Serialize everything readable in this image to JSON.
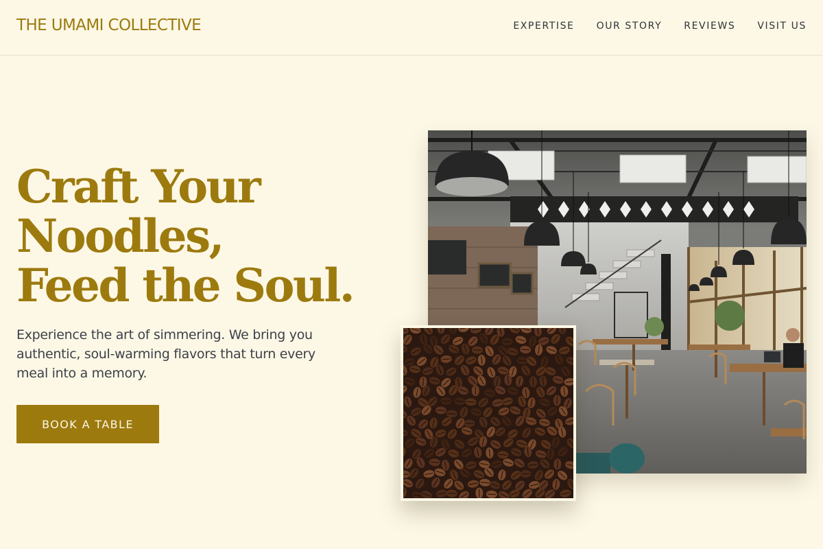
{
  "header": {
    "logo": "THE UMAMI COLLECTIVE",
    "nav": [
      {
        "label": "EXPERTISE"
      },
      {
        "label": "OUR STORY"
      },
      {
        "label": "REVIEWS"
      },
      {
        "label": "VISIT US"
      }
    ]
  },
  "hero": {
    "title_lines": [
      "Craft Your",
      "Noodles,",
      "Feed the Soul."
    ],
    "subtitle": "Experience the art of simmering. We bring you authentic, soul-warming flavors that turn every meal into a memory.",
    "cta_label": "BOOK A TABLE"
  },
  "colors": {
    "background": "#fdf8e6",
    "accent": "#9c7a0e",
    "text": "#3d4049",
    "nav_text": "#2f3136"
  },
  "images": {
    "cafe": {
      "alt": "restaurant interior"
    },
    "beans": {
      "alt": "coffee beans"
    }
  }
}
